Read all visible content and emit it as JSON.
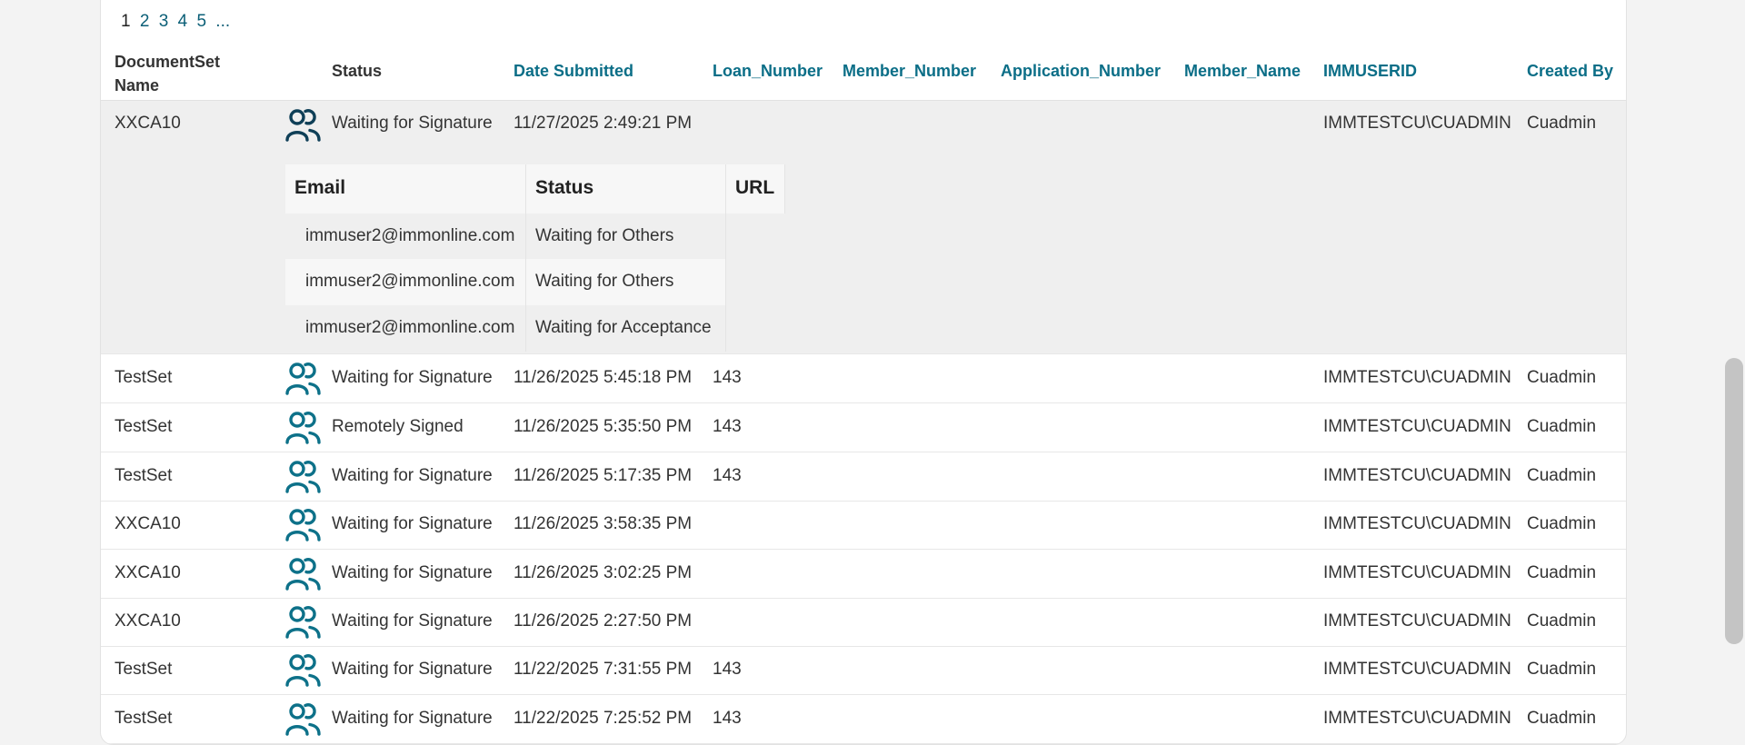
{
  "pagination": {
    "pages": [
      "1",
      "2",
      "3",
      "4",
      "5",
      "..."
    ]
  },
  "columns": {
    "documentset_name": "DocumentSet Name",
    "status": "Status",
    "date_submitted": "Date Submitted",
    "loan_number": "Loan_Number",
    "member_number": "Member_Number",
    "application_number": "Application_Number",
    "member_name": "Member_Name",
    "immuserid": "IMMUSERID",
    "created_by": "Created By"
  },
  "rows": [
    {
      "name": "XXCA10",
      "icon": "signers-icon",
      "status": "Waiting for Signature",
      "date": "11/27/2025 2:49:21 PM",
      "loan": "",
      "userid": "IMMTESTCU\\CUADMIN",
      "created_by": "Cuadmin"
    },
    {
      "name": "TestSet",
      "icon": "signers-icon",
      "status": "Waiting for Signature",
      "date": "11/26/2025 5:45:18 PM",
      "loan": "143",
      "userid": "IMMTESTCU\\CUADMIN",
      "created_by": "Cuadmin"
    },
    {
      "name": "TestSet",
      "icon": "signers-icon",
      "status": "Remotely Signed",
      "date": "11/26/2025 5:35:50 PM",
      "loan": "143",
      "userid": "IMMTESTCU\\CUADMIN",
      "created_by": "Cuadmin"
    },
    {
      "name": "TestSet",
      "icon": "signers-icon",
      "status": "Waiting for Signature",
      "date": "11/26/2025 5:17:35 PM",
      "loan": "143",
      "userid": "IMMTESTCU\\CUADMIN",
      "created_by": "Cuadmin"
    },
    {
      "name": "XXCA10",
      "icon": "signers-icon",
      "status": "Waiting for Signature",
      "date": "11/26/2025 3:58:35 PM",
      "loan": "",
      "userid": "IMMTESTCU\\CUADMIN",
      "created_by": "Cuadmin"
    },
    {
      "name": "XXCA10",
      "icon": "signers-icon",
      "status": "Waiting for Signature",
      "date": "11/26/2025 3:02:25 PM",
      "loan": "",
      "userid": "IMMTESTCU\\CUADMIN",
      "created_by": "Cuadmin"
    },
    {
      "name": "XXCA10",
      "icon": "signers-icon",
      "status": "Waiting for Signature",
      "date": "11/26/2025 2:27:50 PM",
      "loan": "",
      "userid": "IMMTESTCU\\CUADMIN",
      "created_by": "Cuadmin"
    },
    {
      "name": "TestSet",
      "icon": "signers-icon",
      "status": "Waiting for Signature",
      "date": "11/22/2025 7:31:55 PM",
      "loan": "143",
      "userid": "IMMTESTCU\\CUADMIN",
      "created_by": "Cuadmin"
    },
    {
      "name": "TestSet",
      "icon": "signers-icon",
      "status": "Waiting for Signature",
      "date": "11/22/2025 7:25:52 PM",
      "loan": "143",
      "userid": "IMMTESTCU\\CUADMIN",
      "created_by": "Cuadmin"
    }
  ],
  "detail": {
    "headers": {
      "email": "Email",
      "status": "Status",
      "url": "URL"
    },
    "rows": [
      {
        "email": "immuser2@immonline.com",
        "status": "Waiting for Others"
      },
      {
        "email": "immuser2@immonline.com",
        "status": "Waiting for Others"
      },
      {
        "email": "immuser2@immonline.com",
        "status": "Waiting for Acceptance"
      }
    ]
  },
  "colors": {
    "link_teal": "#0b6e87",
    "icon_teal": "#0d7189",
    "icon_dark": "#0f3f57",
    "expanded_bg": "#efefef"
  }
}
